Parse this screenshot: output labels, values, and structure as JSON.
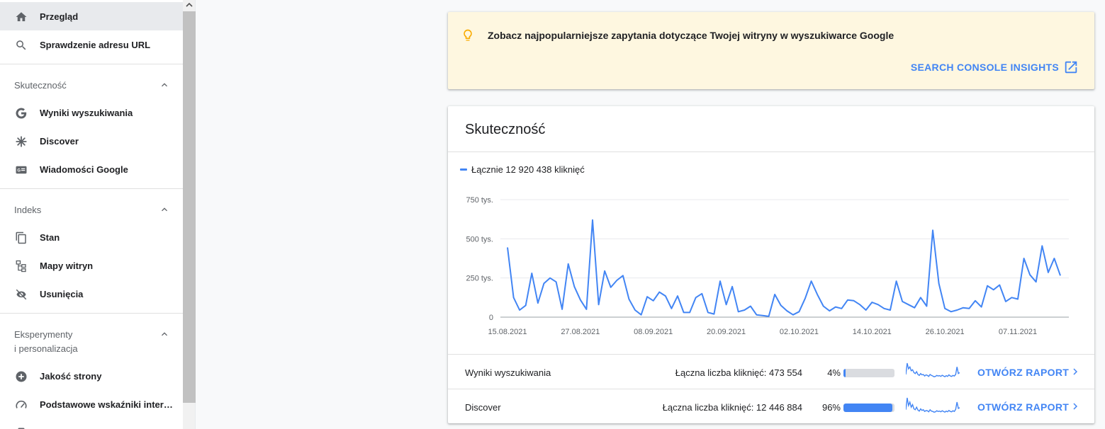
{
  "sidebar": {
    "top_items": [
      {
        "label": "Przegląd",
        "icon": "home-icon",
        "active": true
      },
      {
        "label": "Sprawdzenie adresu URL",
        "icon": "search-icon",
        "active": false
      }
    ],
    "sections": [
      {
        "title": "Skuteczność",
        "items": [
          {
            "label": "Wyniki wyszukiwania",
            "icon": "google-g-icon"
          },
          {
            "label": "Discover",
            "icon": "asterisk-icon"
          },
          {
            "label": "Wiadomości Google",
            "icon": "google-news-icon"
          }
        ]
      },
      {
        "title": "Indeks",
        "items": [
          {
            "label": "Stan",
            "icon": "pages-icon"
          },
          {
            "label": "Mapy witryn",
            "icon": "sitemap-icon"
          },
          {
            "label": "Usunięcia",
            "icon": "eye-off-icon"
          }
        ]
      },
      {
        "title_line1": "Eksperymenty",
        "title_line2": "i personalizacja",
        "items": [
          {
            "label": "Jakość strony",
            "icon": "plus-circle-icon"
          },
          {
            "label": "Podstawowe wskaźniki inter…",
            "icon": "speedometer-icon"
          }
        ]
      }
    ]
  },
  "banner": {
    "text": "Zobacz najpopularniejsze zapytania dotyczące Twojej witryny w wyszukiwarce Google",
    "link_label": "SEARCH CONSOLE INSIGHTS",
    "icon": "lightbulb-icon",
    "link_icon": "open-in-new-icon"
  },
  "card": {
    "title": "Skuteczność",
    "legend": "Łącznie 12 920 438 kliknięć",
    "rows": [
      {
        "name": "Wyniki wyszukiwania",
        "total": "Łączna liczba kliknięć: 473 554",
        "pct_label": "4%",
        "pct": 4,
        "link": "OTWÓRZ RAPORT"
      },
      {
        "name": "Discover",
        "total": "Łączna liczba kliknięć: 12 446 884",
        "pct_label": "96%",
        "pct": 96,
        "link": "OTWÓRZ RAPORT"
      }
    ]
  },
  "colors": {
    "accent": "#4285f4",
    "banner_bg": "#fef7e0",
    "bulb": "#f9ab00"
  },
  "chart_data": {
    "type": "line",
    "ytick_labels": [
      "0",
      "250 tys.",
      "500 tys.",
      "750 tys."
    ],
    "yticks": [
      0,
      250000,
      500000,
      750000
    ],
    "ylim": [
      0,
      750000
    ],
    "xtick_labels": [
      "15.08.2021",
      "27.08.2021",
      "08.09.2021",
      "20.09.2021",
      "02.10.2021",
      "14.10.2021",
      "26.10.2021",
      "07.11.2021"
    ],
    "xtick_index": [
      0,
      12,
      24,
      36,
      48,
      60,
      72,
      84
    ],
    "grid": true,
    "series": [
      {
        "values": [
          445000,
          125000,
          45000,
          75000,
          280000,
          90000,
          215000,
          250000,
          225000,
          50000,
          340000,
          195000,
          110000,
          50000,
          620000,
          80000,
          295000,
          190000,
          235000,
          265000,
          115000,
          45000,
          15000,
          130000,
          105000,
          160000,
          135000,
          55000,
          135000,
          30000,
          30000,
          125000,
          150000,
          30000,
          20000,
          230000,
          80000,
          195000,
          35000,
          45000,
          70000,
          15000,
          10000,
          5000,
          145000,
          75000,
          40000,
          15000,
          35000,
          120000,
          230000,
          145000,
          70000,
          40000,
          65000,
          55000,
          110000,
          105000,
          80000,
          45000,
          95000,
          80000,
          55000,
          45000,
          230000,
          100000,
          80000,
          60000,
          125000,
          70000,
          555000,
          215000,
          55000,
          35000,
          45000,
          60000,
          55000,
          105000,
          65000,
          200000,
          175000,
          205000,
          100000,
          125000,
          115000,
          375000,
          270000,
          225000,
          455000,
          285000,
          375000,
          265000
        ]
      }
    ]
  },
  "sparklines": [
    {
      "values": [
        30,
        90,
        60,
        70,
        50,
        55,
        40,
        35,
        45,
        30,
        25,
        35,
        28,
        30,
        22,
        28,
        25,
        20,
        30,
        25,
        22,
        18,
        20,
        25,
        22,
        24,
        20,
        26,
        22,
        18,
        24,
        20,
        28,
        22,
        20,
        25,
        22,
        30,
        70,
        35,
        40
      ]
    },
    {
      "values": [
        30,
        100,
        55,
        75,
        45,
        60,
        35,
        30,
        45,
        28,
        22,
        35,
        26,
        30,
        20,
        25,
        24,
        18,
        30,
        22,
        20,
        16,
        18,
        24,
        20,
        22,
        18,
        24,
        20,
        16,
        22,
        18,
        26,
        20,
        18,
        24,
        20,
        32,
        75,
        38,
        42
      ]
    }
  ]
}
